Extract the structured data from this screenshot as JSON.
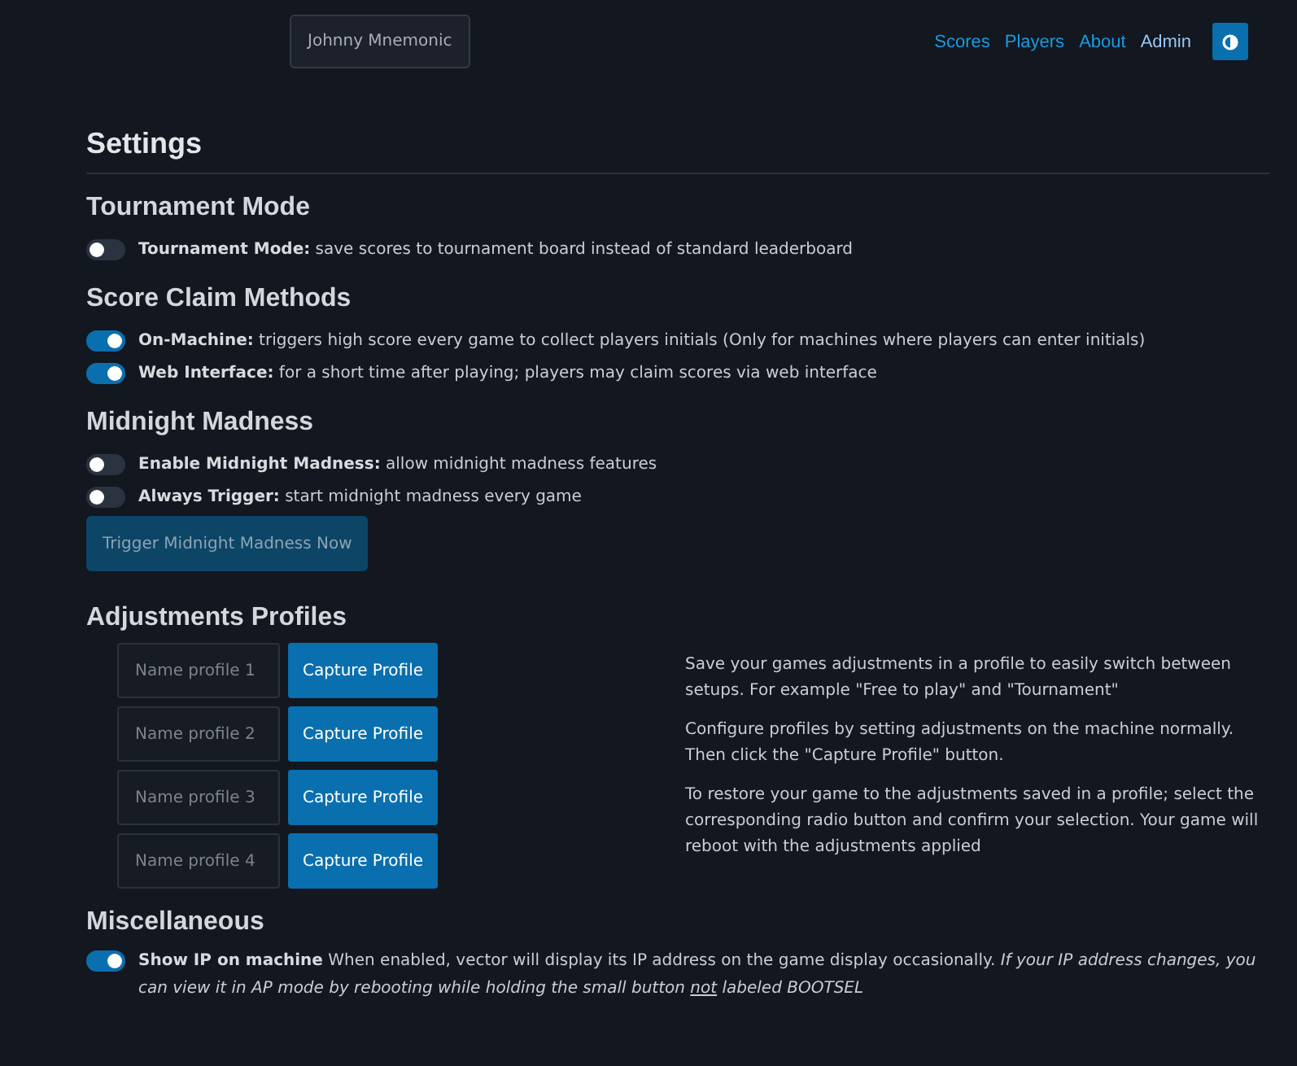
{
  "header": {
    "player_name": "Johnny Mnemonic",
    "nav": [
      {
        "label": "Scores",
        "selected": false
      },
      {
        "label": "Players",
        "selected": false
      },
      {
        "label": "About",
        "selected": false
      },
      {
        "label": "Admin",
        "selected": true
      }
    ]
  },
  "title": "Settings",
  "sections": [
    {
      "heading": "Tournament Mode",
      "toggles": [
        {
          "text": "**Tournament Mode:** save scores to tournament board instead of standard leaderboard",
          "on": false
        }
      ]
    },
    {
      "heading": "Score Claim Methods",
      "toggles": [
        {
          "text": "**On-Machine:** triggers high score every game to collect players initials (Only for machines where players can enter initials)",
          "on": true
        },
        {
          "text": "**Web Interface:** for a short time after playing; players may claim scores via web interface",
          "on": true
        }
      ]
    },
    {
      "heading": "Midnight Madness",
      "toggles": [
        {
          "text": "**Enable Midnight Madness:** allow midnight madness features",
          "on": false
        },
        {
          "text": "**Always Trigger:** start midnight madness every game",
          "on": false
        }
      ],
      "button": {
        "label": "Trigger Midnight Madness Now",
        "disabled": true
      }
    }
  ],
  "profiles": {
    "heading": "Adjustments Profiles",
    "rows": [
      {
        "placeholder": "Name profile 1",
        "button": "Capture Profile"
      },
      {
        "placeholder": "Name profile 2",
        "button": "Capture Profile"
      },
      {
        "placeholder": "Name profile 3",
        "button": "Capture Profile"
      },
      {
        "placeholder": "Name profile 4",
        "button": "Capture Profile"
      }
    ],
    "help": [
      "Save your games adjustments in a profile to easily switch between setups. For example \"Free to play\" and \"Tournament\"",
      "Configure profiles by setting adjustments on the machine normally. Then click the \"Capture Profile\" button.",
      "To restore your game to the adjustments saved in a profile; select the corresponding radio button and confirm your selection. Your game will reboot with the adjustments applied"
    ]
  },
  "misc": {
    "heading": "Miscellaneous",
    "toggle": {
      "on": true,
      "label": "Show IP on machine",
      "description": "When enabled, vector will display its IP address on the game display occasionally.",
      "note": {
        "before": "If your IP address changes, you can view it in AP mode by rebooting while holding the small button",
        "emphasis": "not",
        "after": "labeled BOOTSEL"
      }
    }
  }
}
